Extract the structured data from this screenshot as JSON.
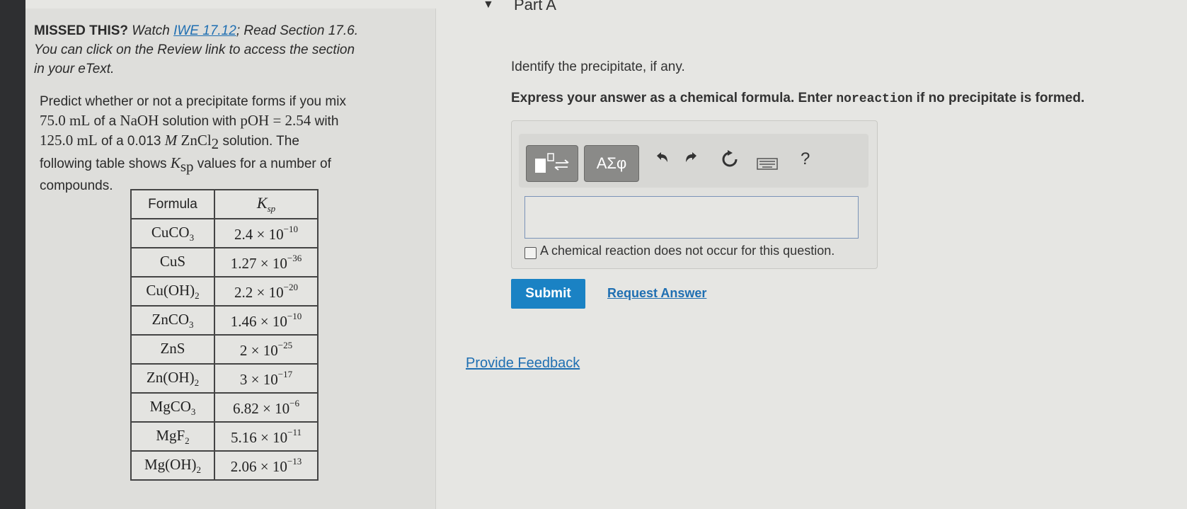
{
  "missed": {
    "prefix": "MISSED THIS?",
    "watch": "Watch",
    "link": "IWE 17.12",
    "read": "; Read Section 17.6.",
    "line2": "You can click on the Review link to access the section",
    "line3": "in your eText."
  },
  "problem": {
    "l1": "Predict whether or not a precipitate forms if you mix",
    "l2a": "75.0 mL",
    "l2b": " of a ",
    "l2c": "NaOH",
    "l2d": " solution with ",
    "l2e": "pOH = 2.54",
    "l2f": " with",
    "l3a": "125.0 mL",
    "l3b": " of a 0.013 ",
    "l3c": "M",
    "l3d": " ZnCl",
    "l3e": "2",
    "l3f": " solution. The",
    "l4a": "following table shows ",
    "l4b": "K",
    "l4c": "sp",
    "l4d": " values for a number of",
    "l5": "compounds."
  },
  "table": {
    "header_formula": "Formula",
    "header_k": "K",
    "header_k_sub": "sp",
    "rows": [
      {
        "f1": "CuCO",
        "f2": "3",
        "f3": "",
        "f4": "",
        "v": "2.4 × 10",
        "e": "−10"
      },
      {
        "f1": "CuS",
        "f2": "",
        "f3": "",
        "f4": "",
        "v": "1.27 × 10",
        "e": "−36"
      },
      {
        "f1": "Cu(OH)",
        "f2": "2",
        "f3": "",
        "f4": "",
        "v": "2.2 × 10",
        "e": "−20"
      },
      {
        "f1": "ZnCO",
        "f2": "3",
        "f3": "",
        "f4": "",
        "v": "1.46 × 10",
        "e": "−10"
      },
      {
        "f1": "ZnS",
        "f2": "",
        "f3": "",
        "f4": "",
        "v": "2 × 10",
        "e": "−25"
      },
      {
        "f1": "Zn(OH)",
        "f2": "2",
        "f3": "",
        "f4": "",
        "v": "3 × 10",
        "e": "−17"
      },
      {
        "f1": "MgCO",
        "f2": "3",
        "f3": "",
        "f4": "",
        "v": "6.82 × 10",
        "e": "−6"
      },
      {
        "f1": "MgF",
        "f2": "2",
        "f3": "",
        "f4": "",
        "v": "5.16 × 10",
        "e": "−11"
      },
      {
        "f1": "Mg(OH)",
        "f2": "2",
        "f3": "",
        "f4": "",
        "v": "2.06 × 10",
        "e": "−13"
      }
    ]
  },
  "part": {
    "title": "Part A",
    "question": "Identify the precipitate, if any.",
    "express_a": "Express your answer as a chemical formula. Enter ",
    "express_code": "noreaction",
    "express_b": " if no precipitate is formed."
  },
  "toolbar": {
    "greek": "ΑΣφ",
    "help": "?"
  },
  "answer": {
    "value": "",
    "checkbox_label": "A chemical reaction does not occur for this question."
  },
  "actions": {
    "submit": "Submit",
    "request": "Request Answer",
    "feedback": "Provide Feedback"
  }
}
